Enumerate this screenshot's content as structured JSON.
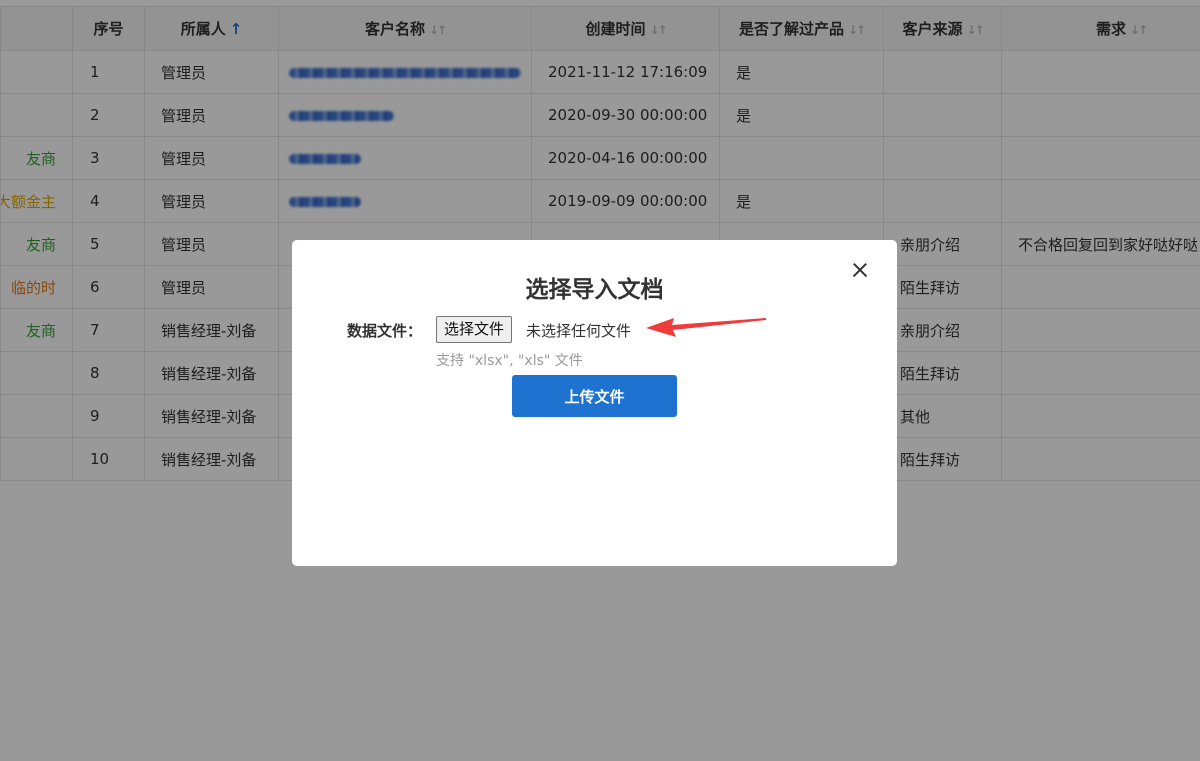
{
  "table": {
    "headers": [
      {
        "label": "",
        "sort": ""
      },
      {
        "label": "序号",
        "sort": ""
      },
      {
        "label": "所属人",
        "sort": "asc"
      },
      {
        "label": "客户名称",
        "sort": "both"
      },
      {
        "label": "创建时间",
        "sort": "both"
      },
      {
        "label": "是否了解过产品",
        "sort": "both"
      },
      {
        "label": "客户来源",
        "sort": "both"
      },
      {
        "label": "需求",
        "sort": "both"
      }
    ],
    "rows": [
      {
        "tag": "",
        "tag_color": "",
        "no": "1",
        "owner": "管理员",
        "created": "2021-11-12 17:16:09",
        "known": "是",
        "source": "",
        "need": ""
      },
      {
        "tag": "",
        "tag_color": "",
        "no": "2",
        "owner": "管理员",
        "created": "2020-09-30 00:00:00",
        "known": "是",
        "source": "",
        "need": ""
      },
      {
        "tag": "友商",
        "tag_color": "#3aa13a",
        "no": "3",
        "owner": "管理员",
        "created": "2020-04-16 00:00:00",
        "known": "",
        "source": "",
        "need": ""
      },
      {
        "tag": "大额金主",
        "tag_color": "#e0a800",
        "no": "4",
        "owner": "管理员",
        "created": "2019-09-09 00:00:00",
        "known": "是",
        "source": "",
        "need": ""
      },
      {
        "tag": "友商",
        "tag_color": "#3aa13a",
        "no": "5",
        "owner": "管理员",
        "created": "",
        "known": "",
        "source": "亲朋介绍",
        "need": "不合格回复回到家好哒好哒"
      },
      {
        "tag": "临的时",
        "tag_color": "#e07a1a",
        "no": "6",
        "owner": "管理员",
        "created": "",
        "known": "",
        "source": "陌生拜访",
        "need": ""
      },
      {
        "tag": "友商",
        "tag_color": "#3aa13a",
        "no": "7",
        "owner": "销售经理-刘备",
        "created": "",
        "known": "",
        "source": "亲朋介绍",
        "need": ""
      },
      {
        "tag": "",
        "tag_color": "",
        "no": "8",
        "owner": "销售经理-刘备",
        "created": "",
        "known": "",
        "source": "陌生拜访",
        "need": ""
      },
      {
        "tag": "",
        "tag_color": "",
        "no": "9",
        "owner": "销售经理-刘备",
        "created": "",
        "known": "",
        "source": "其他",
        "need": ""
      },
      {
        "tag": "",
        "tag_color": "",
        "no": "10",
        "owner": "销售经理-刘备",
        "created": "",
        "known": "",
        "source": "陌生拜访",
        "need": ""
      }
    ]
  },
  "modal": {
    "title": "选择导入文档",
    "field_label": "数据文件：",
    "file_button": "选择文件",
    "file_status": "未选择任何文件",
    "hint": "支持 \"xlsx\", \"xls\" 文件",
    "upload_button": "上传文件"
  },
  "colors": {
    "accent": "#1e73d0",
    "arrow": "#ee3b3b"
  }
}
